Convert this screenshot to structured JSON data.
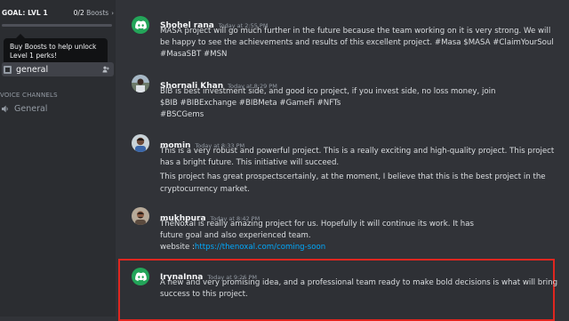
{
  "sidebar": {
    "goal_title": "GOAL: LVL 1",
    "goal_count": "0/2",
    "goal_count_suffix": "Boosts",
    "goal_arrow": "›",
    "goal_progress": 0,
    "tooltip": "Buy Boosts to help unlock Level 1 perks!",
    "text_channel": "general",
    "voice_header": "VOICE CHANNELS",
    "voice_channel": "General"
  },
  "messages": [
    {
      "author": "Shohel rana",
      "timestamp": "Today at 2:55 PM",
      "avatar": "discord-logo",
      "lines": [
        "MASA project will go much further in the future because the team working on it is very strong. We will",
        "be happy to see the achievements and results of this excellent project. #Masa $MASA #ClaimYourSoul",
        "#MasaSBT #MSN"
      ]
    },
    {
      "author": "Shornali Khan",
      "timestamp": "Today at 8:29 PM",
      "avatar": "photo",
      "lines": [
        "BIB is  best investment side, and good ico project, if you invest side, no loss money, join",
        "$BIB #BIBExchange #BIBMeta #GameFi #NFTs",
        "#BSCGems"
      ]
    },
    {
      "author": "momin",
      "timestamp": "Today at 8:33 PM",
      "avatar": "photo",
      "lines": [
        "This is a very robust and powerful project. This is a really exciting and high-quality project. This project",
        "has a bright future. This initiative will succeed.",
        "This project has great prospectscertainly, at the moment, I believe that this is the best project in the",
        "cryptocurrency market."
      ]
    },
    {
      "author": "mukhpura",
      "timestamp": "Today at 8:42 PM",
      "avatar": "photo",
      "lines": [
        "TheNoxal is really amazing project for us. Hopefully it will continue its work. It has",
        "future goal and also experienced team.",
        "website :"
      ],
      "link": "https://thenoxal.com/coming-soon"
    },
    {
      "author": "IrynaInna",
      "timestamp": "Today at 9:26 PM",
      "avatar": "discord-logo",
      "lines": [
        "A new and very promising idea, and a professional team ready to make bold decisions is what will bring",
        "success to this project."
      ]
    }
  ],
  "colors": {
    "background": "#313338",
    "sidebar": "#2b2d31",
    "discord_green": "#23a559",
    "link": "#00a8fc",
    "highlight_border": "#e0261f"
  },
  "icons": [
    "discord-logo-icon",
    "hash-icon",
    "speaker-icon",
    "add-member-icon"
  ]
}
